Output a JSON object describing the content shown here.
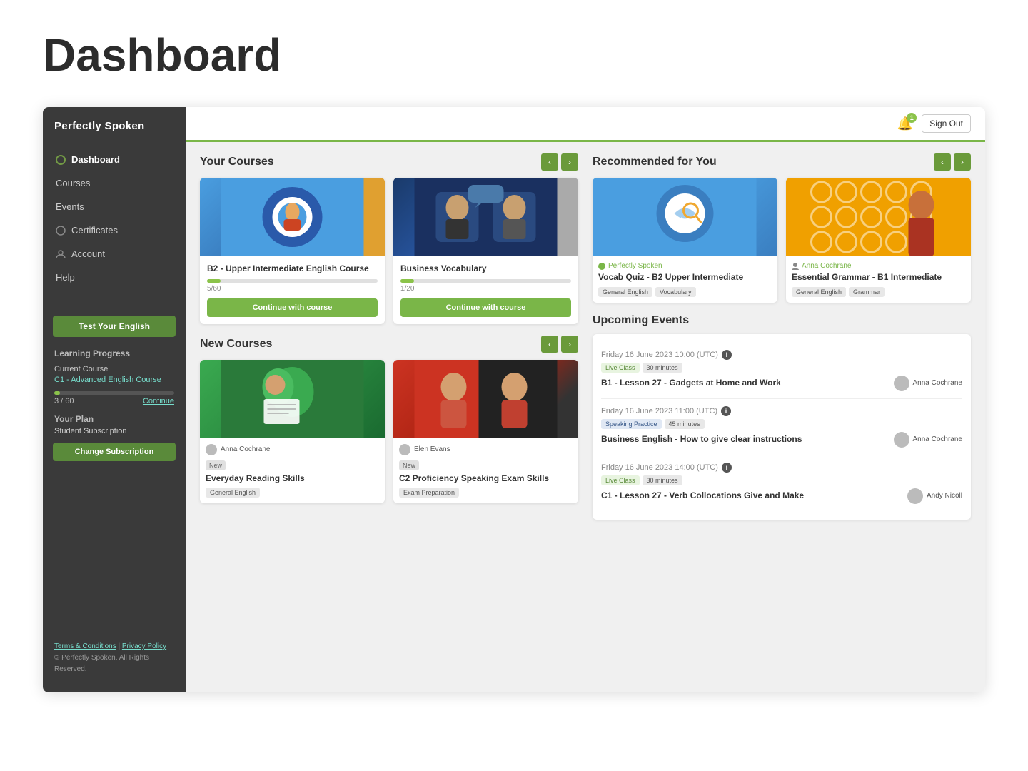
{
  "page": {
    "title": "Dashboard"
  },
  "sidebar": {
    "logo": "Perfectly Spoken",
    "nav": [
      {
        "label": "Dashboard",
        "active": true,
        "icon": "circle"
      },
      {
        "label": "Courses",
        "active": false,
        "icon": "none"
      },
      {
        "label": "Events",
        "active": false,
        "icon": "none"
      },
      {
        "label": "Certificates",
        "active": false,
        "icon": "circle-outline"
      },
      {
        "label": "Account",
        "active": false,
        "icon": "person"
      },
      {
        "label": "Help",
        "active": false,
        "icon": "none"
      }
    ],
    "test_btn": "Test Your English",
    "learning_progress": "Learning Progress",
    "current_course_label": "Current Course",
    "current_course_name": "C1 - Advanced English Course",
    "progress_label": "3 / 60",
    "continue_label": "Continue",
    "your_plan": "Your Plan",
    "subscription": "Student Subscription",
    "change_sub_btn": "Change Subscription",
    "footer_links": [
      "Terms & Conditions",
      "Privacy Policy"
    ],
    "footer_copy": "© Perfectly Spoken. All Rights Reserved."
  },
  "topbar": {
    "notif_count": "1",
    "sign_out": "Sign Out"
  },
  "your_courses": {
    "title": "Your Courses",
    "cards": [
      {
        "title": "B2 - Upper Intermediate English Course",
        "progress": "5/60",
        "progress_pct": 8,
        "btn": "Continue with course"
      },
      {
        "title": "Business Vocabulary",
        "progress": "1/20",
        "progress_pct": 5,
        "btn": "Continue with course"
      }
    ]
  },
  "recommended": {
    "title": "Recommended for You",
    "cards": [
      {
        "provider": "Perfectly Spoken",
        "title": "Vocab Quiz - B2 Upper Intermediate",
        "tags": [
          "General English",
          "Vocabulary"
        ]
      },
      {
        "provider": "Anna Cochrane",
        "title": "Essential Grammar - B1 Intermediate",
        "tags": [
          "General English",
          "Grammar"
        ]
      }
    ]
  },
  "new_courses": {
    "title": "New Courses",
    "cards": [
      {
        "author": "Anna Cochrane",
        "badge": "New",
        "title": "Everyday Reading Skills",
        "tag": "General English"
      },
      {
        "author": "Elen Evans",
        "badge": "New",
        "title": "C2 Proficiency Speaking Exam Skills",
        "tag": "Exam Preparation"
      }
    ]
  },
  "upcoming_events": {
    "title": "Upcoming Events",
    "events": [
      {
        "date": "Friday 16 June 2023 10:00 (UTC)",
        "tags": [
          "Live Class",
          "30 minutes"
        ],
        "title": "B1 - Lesson 27 - Gadgets at Home and Work",
        "teacher": "Anna Cochrane"
      },
      {
        "date": "Friday 16 June 2023 11:00 (UTC)",
        "tags": [
          "Speaking Practice",
          "45 minutes"
        ],
        "title": "Business English - How to give clear instructions",
        "teacher": "Anna Cochrane"
      },
      {
        "date": "Friday 16 June 2023 14:00 (UTC)",
        "tags": [
          "Live Class",
          "30 minutes"
        ],
        "title": "C1 - Lesson 27 - Verb Collocations Give and Make",
        "teacher": "Andy Nicoll"
      }
    ]
  }
}
